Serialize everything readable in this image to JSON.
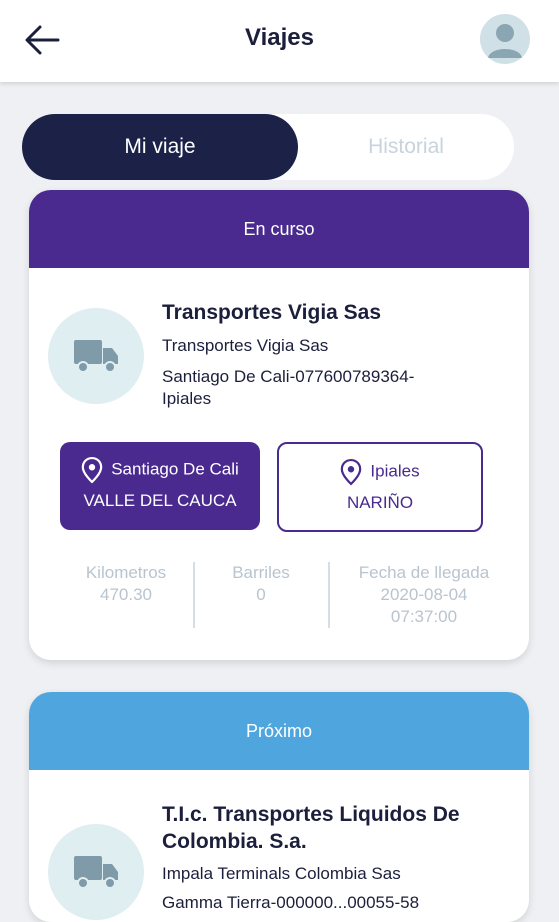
{
  "header": {
    "title": "Viajes"
  },
  "tabs": [
    {
      "label": "Mi viaje"
    },
    {
      "label": "Historial"
    }
  ],
  "trips": [
    {
      "status": "En curso",
      "status_color": "#4a2a8e",
      "company": "Transportes Vigia Sas",
      "client": "Transportes Vigia Sas",
      "route_line1": "Santiago De Cali-077600789364-",
      "route_line2": "Ipiales",
      "origin": {
        "city": "Santiago De Cali",
        "department": "VALLE DEL CAUCA"
      },
      "destination": {
        "city": "Ipiales",
        "department": "NARIÑO"
      },
      "stats": {
        "km_label": "Kilometros",
        "km_value": "470.30",
        "barrels_label": "Barriles",
        "barrels_value": "0",
        "arrival_label": "Fecha de llegada",
        "arrival_date": "2020-08-04",
        "arrival_time": "07:37:00"
      }
    },
    {
      "status": "Próximo",
      "status_color": "#4fa6df",
      "company_line1": "T.I.c. Transportes Liquidos De",
      "company_line2": "Colombia. S.a.",
      "client": "Impala Terminals Colombia Sas",
      "route_line1": "Gamma Tierra-000000...00055-58"
    }
  ]
}
